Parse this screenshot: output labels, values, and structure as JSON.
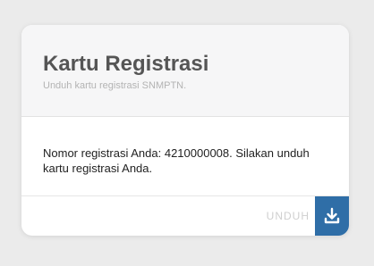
{
  "card": {
    "title": "Kartu Registrasi",
    "subtitle": "Unduh kartu registrasi SNMPTN.",
    "message": "Nomor registrasi Anda: 4210000008. Silakan unduh kartu registrasi Anda.",
    "download_label": "UNDUH",
    "download_icon": "download-icon"
  },
  "colors": {
    "background": "#ebebeb",
    "header_bg": "#f6f6f7",
    "accent": "#2f6ea7",
    "title": "#555555",
    "subtitle": "#b3b3b3"
  }
}
